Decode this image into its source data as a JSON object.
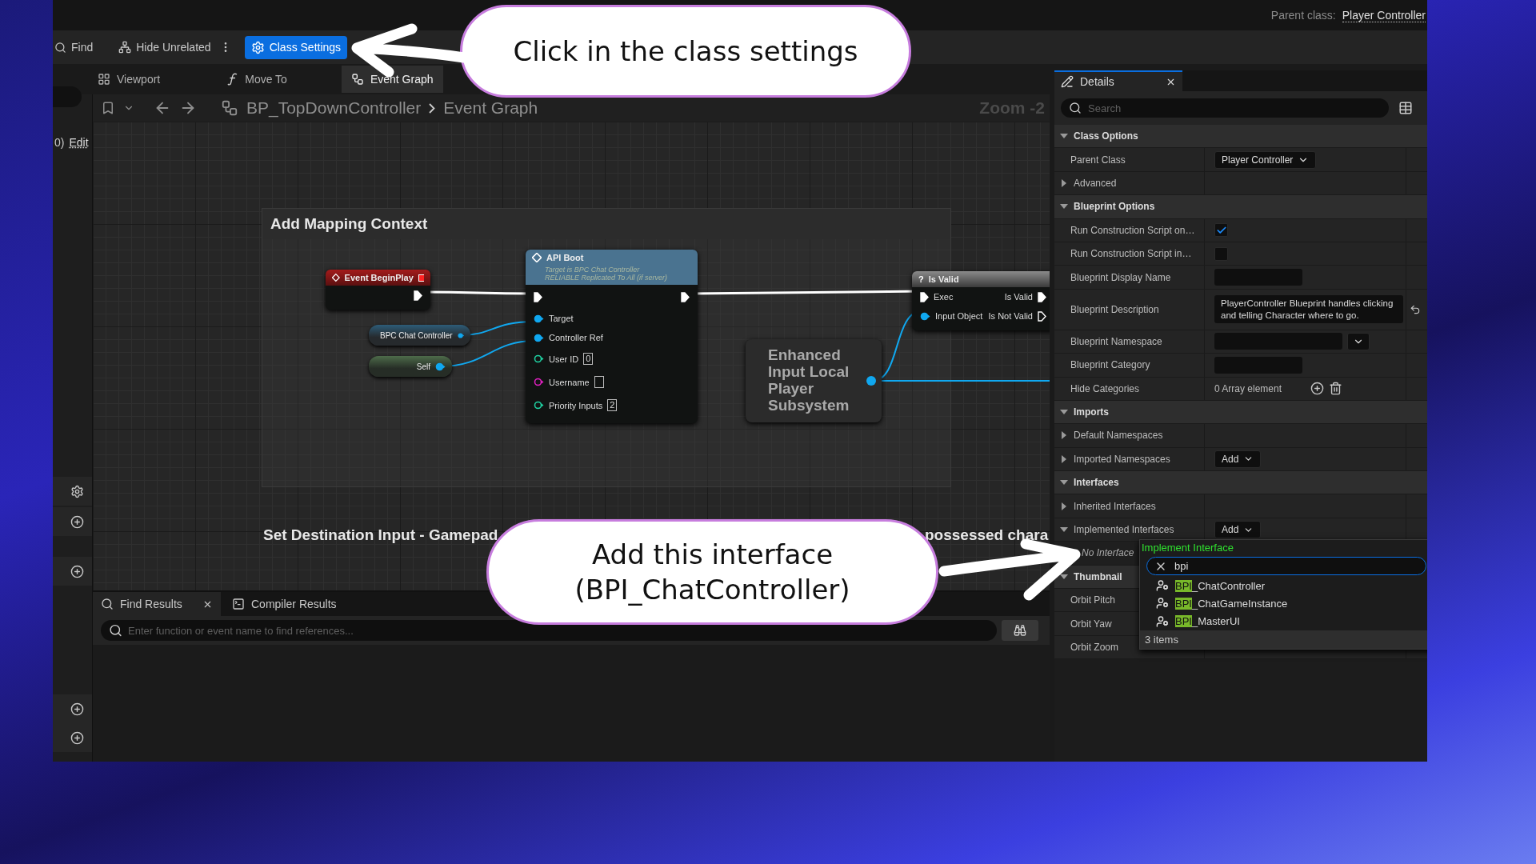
{
  "top_bar": {
    "parent_label": "Parent class:",
    "parent_value": "Player Controller"
  },
  "toolbar": {
    "find": "Find",
    "hide_unrelated": "Hide Unrelated",
    "class_settings": {
      "label": "Class Settings",
      "selected": true
    }
  },
  "document_tabs": [
    {
      "label": "Viewport",
      "kind": "viewport",
      "selected": false
    },
    {
      "label": "Move To",
      "kind": "function",
      "selected": false
    },
    {
      "label": "Event Graph",
      "kind": "graph",
      "selected": true
    }
  ],
  "sidebar": {
    "edit_prefix": "0)",
    "edit_link": "Edit"
  },
  "breadcrumb": {
    "blueprint": "BP_TopDownController",
    "graph": "Event Graph",
    "zoom": "Zoom -2"
  },
  "graph": {
    "comments": [
      {
        "title": "Add Mapping Context"
      },
      {
        "title": "Set Destination Input - Gamepad"
      }
    ],
    "comment_fragment": "possessed chara",
    "event_node": {
      "title": "Event BeginPlay"
    },
    "variables": [
      {
        "label": "BPC Chat Controller",
        "kind": "component"
      },
      {
        "label": "Self",
        "kind": "self"
      }
    ],
    "function_node": {
      "title": "API Boot",
      "subtitle": [
        "Target is BPC Chat Controller",
        "RELIABLE Replicated To All (if server)"
      ],
      "pins": [
        {
          "label": "Target",
          "kind": "object",
          "connected": true
        },
        {
          "label": "Controller Ref",
          "kind": "object",
          "connected": true
        },
        {
          "label": "User ID",
          "kind": "integer",
          "connected": false,
          "value": "0"
        },
        {
          "label": "Username",
          "kind": "string",
          "connected": false
        },
        {
          "label": "Priority Inputs",
          "kind": "integer",
          "connected": false,
          "value": "2"
        }
      ]
    },
    "subsystem_node": {
      "title": "Enhanced Input Local Player Subsystem"
    },
    "is_valid_node": {
      "icon": "?",
      "title": "Is Valid",
      "inputs": [
        {
          "label": "Exec",
          "kind": "exec"
        },
        {
          "label": "Input Object",
          "kind": "object"
        }
      ],
      "outputs": [
        {
          "label": "Is Valid",
          "connected": true
        },
        {
          "label": "Is Not Valid",
          "connected": false
        }
      ]
    }
  },
  "bottom_panel": {
    "tabs": [
      {
        "label": "Find Results",
        "kind": "search",
        "selected": true
      },
      {
        "label": "Compiler Results",
        "kind": "log",
        "selected": false
      }
    ],
    "search": {
      "placeholder": "Enter function or event name to find references..."
    }
  },
  "details": {
    "title": "Details",
    "search": {
      "placeholder": "Search"
    },
    "rows": [
      {
        "kind": "section",
        "label": "Class Options",
        "expanded": true
      },
      {
        "kind": "property",
        "label": "Parent Class",
        "value": {
          "kind": "dropdown",
          "text": "Player Controller"
        }
      },
      {
        "kind": "group",
        "label": "Advanced",
        "expanded": false
      },
      {
        "kind": "section",
        "label": "Blueprint Options",
        "expanded": true
      },
      {
        "kind": "property",
        "label": "Run Construction Script on…",
        "value": {
          "kind": "checkbox",
          "checked": true
        }
      },
      {
        "kind": "property",
        "label": "Run Construction Script in…",
        "value": {
          "kind": "checkbox",
          "checked": false
        }
      },
      {
        "kind": "property",
        "label": "Blueprint Display Name",
        "value": {
          "kind": "text"
        }
      },
      {
        "kind": "property",
        "label": "Blueprint Description",
        "reset": true,
        "value": {
          "kind": "textarea",
          "text": "PlayerController Blueprint handles clicking and telling Character where to go."
        }
      },
      {
        "kind": "property",
        "label": "Blueprint Namespace",
        "value": {
          "kind": "combo"
        }
      },
      {
        "kind": "property",
        "label": "Blueprint Category",
        "value": {
          "kind": "text"
        }
      },
      {
        "kind": "property",
        "label": "Hide Categories",
        "value": {
          "kind": "array",
          "text": "0 Array element"
        }
      },
      {
        "kind": "section",
        "label": "Imports",
        "expanded": true
      },
      {
        "kind": "group",
        "label": "Default Namespaces",
        "expanded": false
      },
      {
        "kind": "group",
        "label": "Imported Namespaces",
        "expanded": false,
        "value": {
          "kind": "add",
          "text": "Add"
        }
      },
      {
        "kind": "section",
        "label": "Interfaces",
        "expanded": true
      },
      {
        "kind": "group",
        "label": "Inherited Interfaces",
        "expanded": false
      },
      {
        "kind": "group",
        "label": "Implemented Interfaces",
        "expanded": true,
        "value": {
          "kind": "add",
          "text": "Add"
        }
      },
      {
        "kind": "note",
        "label": "No Interface"
      },
      {
        "kind": "section",
        "label": "Thumbnail",
        "expanded": true
      },
      {
        "kind": "property",
        "label": "Orbit Pitch"
      },
      {
        "kind": "property",
        "label": "Orbit Yaw"
      },
      {
        "kind": "property",
        "label": "Orbit Zoom"
      }
    ]
  },
  "interface_popup": {
    "title": "Implement Interface",
    "search_value": "bpi",
    "items": [
      {
        "match": "BPI",
        "rest": "_ChatController"
      },
      {
        "match": "BPI",
        "rest": "_ChatGameInstance"
      },
      {
        "match": "BPI",
        "rest": "_MasterUI"
      }
    ],
    "footer": "3 items"
  },
  "callouts": [
    {
      "lines": [
        "Click in the class settings"
      ]
    },
    {
      "lines": [
        "Add this interface",
        "(BPI_ChatController)"
      ]
    }
  ]
}
